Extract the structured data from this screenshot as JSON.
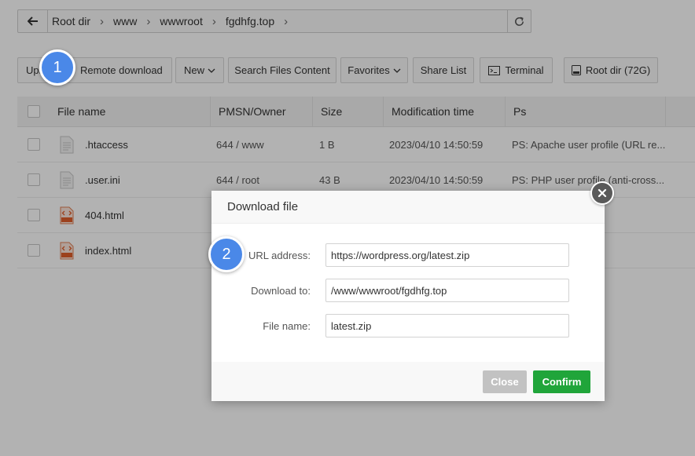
{
  "path": {
    "crumbs": [
      "Root dir",
      "www",
      "wwwroot",
      "fgdhfg.top"
    ]
  },
  "toolbar": {
    "upload_label": "Upload",
    "remote_download_label": "Remote download",
    "new_label": "New",
    "search_label": "Search Files Content",
    "favorites_label": "Favorites",
    "share_label": "Share List",
    "terminal_label": "Terminal",
    "root_label": "Root dir (72G)"
  },
  "table": {
    "headers": [
      "File name",
      "PMSN/Owner",
      "Size",
      "Modification time",
      "Ps"
    ],
    "rows": [
      {
        "name": ".htaccess",
        "perm": "644 / www",
        "size": "1 B",
        "mtime": "2023/04/10 14:50:59",
        "ps": "PS: Apache user profile (URL re...",
        "icon": "document-icon"
      },
      {
        "name": ".user.ini",
        "perm": "644 / root",
        "size": "43 B",
        "mtime": "2023/04/10 14:50:59",
        "ps": "PS: PHP user profile (anti-cross...",
        "icon": "document-icon"
      },
      {
        "name": "404.html",
        "perm": "",
        "size": "",
        "mtime": "",
        "ps": "",
        "icon": "html-file-icon"
      },
      {
        "name": "index.html",
        "perm": "",
        "size": "",
        "mtime": "",
        "ps": "",
        "icon": "html-file-icon"
      }
    ]
  },
  "badges": {
    "step1": "1",
    "step2": "2"
  },
  "dialog": {
    "title": "Download file",
    "url_label": "URL address:",
    "url_value": "https://wordpress.org/latest.zip",
    "dest_label": "Download to:",
    "dest_value": "/www/wwwroot/fgdhfg.top",
    "filename_label": "File name:",
    "filename_value": "latest.zip",
    "close_label": "Close",
    "confirm_label": "Confirm"
  },
  "colors": {
    "badge": "#4a88e8",
    "confirm": "#20a53a",
    "close_button": "#c2c2c2"
  }
}
